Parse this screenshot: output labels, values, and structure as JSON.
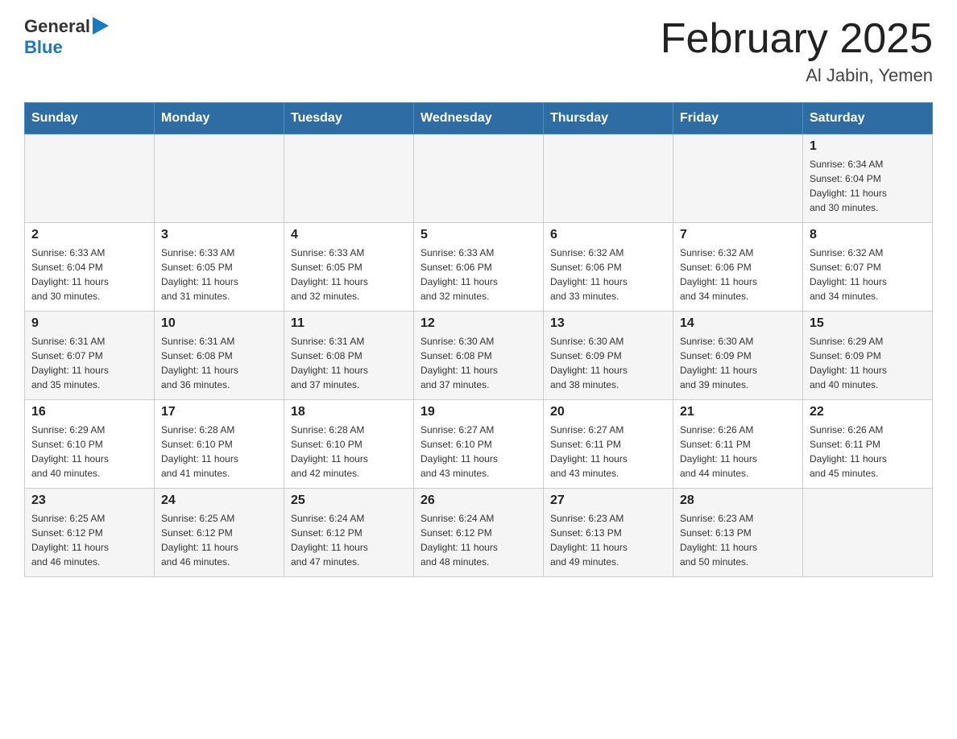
{
  "logo": {
    "general": "General",
    "blue": "Blue",
    "arrow": "▶"
  },
  "title": "February 2025",
  "location": "Al Jabin, Yemen",
  "headers": [
    "Sunday",
    "Monday",
    "Tuesday",
    "Wednesday",
    "Thursday",
    "Friday",
    "Saturday"
  ],
  "weeks": [
    {
      "days": [
        {
          "num": "",
          "info": ""
        },
        {
          "num": "",
          "info": ""
        },
        {
          "num": "",
          "info": ""
        },
        {
          "num": "",
          "info": ""
        },
        {
          "num": "",
          "info": ""
        },
        {
          "num": "",
          "info": ""
        },
        {
          "num": "1",
          "info": "Sunrise: 6:34 AM\nSunset: 6:04 PM\nDaylight: 11 hours\nand 30 minutes."
        }
      ]
    },
    {
      "days": [
        {
          "num": "2",
          "info": "Sunrise: 6:33 AM\nSunset: 6:04 PM\nDaylight: 11 hours\nand 30 minutes."
        },
        {
          "num": "3",
          "info": "Sunrise: 6:33 AM\nSunset: 6:05 PM\nDaylight: 11 hours\nand 31 minutes."
        },
        {
          "num": "4",
          "info": "Sunrise: 6:33 AM\nSunset: 6:05 PM\nDaylight: 11 hours\nand 32 minutes."
        },
        {
          "num": "5",
          "info": "Sunrise: 6:33 AM\nSunset: 6:06 PM\nDaylight: 11 hours\nand 32 minutes."
        },
        {
          "num": "6",
          "info": "Sunrise: 6:32 AM\nSunset: 6:06 PM\nDaylight: 11 hours\nand 33 minutes."
        },
        {
          "num": "7",
          "info": "Sunrise: 6:32 AM\nSunset: 6:06 PM\nDaylight: 11 hours\nand 34 minutes."
        },
        {
          "num": "8",
          "info": "Sunrise: 6:32 AM\nSunset: 6:07 PM\nDaylight: 11 hours\nand 34 minutes."
        }
      ]
    },
    {
      "days": [
        {
          "num": "9",
          "info": "Sunrise: 6:31 AM\nSunset: 6:07 PM\nDaylight: 11 hours\nand 35 minutes."
        },
        {
          "num": "10",
          "info": "Sunrise: 6:31 AM\nSunset: 6:08 PM\nDaylight: 11 hours\nand 36 minutes."
        },
        {
          "num": "11",
          "info": "Sunrise: 6:31 AM\nSunset: 6:08 PM\nDaylight: 11 hours\nand 37 minutes."
        },
        {
          "num": "12",
          "info": "Sunrise: 6:30 AM\nSunset: 6:08 PM\nDaylight: 11 hours\nand 37 minutes."
        },
        {
          "num": "13",
          "info": "Sunrise: 6:30 AM\nSunset: 6:09 PM\nDaylight: 11 hours\nand 38 minutes."
        },
        {
          "num": "14",
          "info": "Sunrise: 6:30 AM\nSunset: 6:09 PM\nDaylight: 11 hours\nand 39 minutes."
        },
        {
          "num": "15",
          "info": "Sunrise: 6:29 AM\nSunset: 6:09 PM\nDaylight: 11 hours\nand 40 minutes."
        }
      ]
    },
    {
      "days": [
        {
          "num": "16",
          "info": "Sunrise: 6:29 AM\nSunset: 6:10 PM\nDaylight: 11 hours\nand 40 minutes."
        },
        {
          "num": "17",
          "info": "Sunrise: 6:28 AM\nSunset: 6:10 PM\nDaylight: 11 hours\nand 41 minutes."
        },
        {
          "num": "18",
          "info": "Sunrise: 6:28 AM\nSunset: 6:10 PM\nDaylight: 11 hours\nand 42 minutes."
        },
        {
          "num": "19",
          "info": "Sunrise: 6:27 AM\nSunset: 6:10 PM\nDaylight: 11 hours\nand 43 minutes."
        },
        {
          "num": "20",
          "info": "Sunrise: 6:27 AM\nSunset: 6:11 PM\nDaylight: 11 hours\nand 43 minutes."
        },
        {
          "num": "21",
          "info": "Sunrise: 6:26 AM\nSunset: 6:11 PM\nDaylight: 11 hours\nand 44 minutes."
        },
        {
          "num": "22",
          "info": "Sunrise: 6:26 AM\nSunset: 6:11 PM\nDaylight: 11 hours\nand 45 minutes."
        }
      ]
    },
    {
      "days": [
        {
          "num": "23",
          "info": "Sunrise: 6:25 AM\nSunset: 6:12 PM\nDaylight: 11 hours\nand 46 minutes."
        },
        {
          "num": "24",
          "info": "Sunrise: 6:25 AM\nSunset: 6:12 PM\nDaylight: 11 hours\nand 46 minutes."
        },
        {
          "num": "25",
          "info": "Sunrise: 6:24 AM\nSunset: 6:12 PM\nDaylight: 11 hours\nand 47 minutes."
        },
        {
          "num": "26",
          "info": "Sunrise: 6:24 AM\nSunset: 6:12 PM\nDaylight: 11 hours\nand 48 minutes."
        },
        {
          "num": "27",
          "info": "Sunrise: 6:23 AM\nSunset: 6:13 PM\nDaylight: 11 hours\nand 49 minutes."
        },
        {
          "num": "28",
          "info": "Sunrise: 6:23 AM\nSunset: 6:13 PM\nDaylight: 11 hours\nand 50 minutes."
        },
        {
          "num": "",
          "info": ""
        }
      ]
    }
  ]
}
